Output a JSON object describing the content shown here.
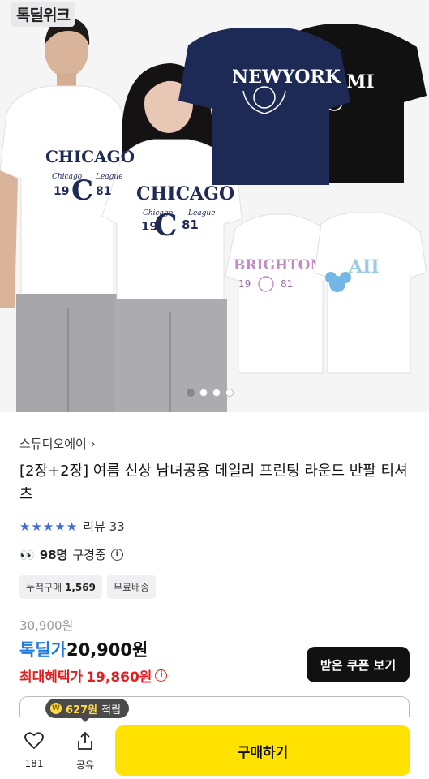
{
  "hero": {
    "badge": "톡딜위크",
    "carousel_pages": 4,
    "carousel_active": 1,
    "shirts": {
      "chicago_text": "CHICAGO",
      "chicago_sub_left": "Chicago",
      "chicago_sub_right": "League",
      "chicago_year_left": "19",
      "chicago_letter": "C",
      "chicago_year_right": "81",
      "newyork_text": "NEWYORK",
      "miami_text": "AMI",
      "brighton_text": "BRIGHTON",
      "brighton_year_left": "19",
      "brighton_year_right": "81",
      "hawaii_text": "AII"
    }
  },
  "product": {
    "seller": "스튜디오에이",
    "seller_chevron": "›",
    "title": "[2장+2장] 여름 신상 남녀공용 데일리 프린팅 라운드 반팔 티셔츠",
    "stars": "★★★★★",
    "review_label": "리뷰 33",
    "watch_icon": "👀",
    "watch_count": "98명",
    "watch_label": "구경중",
    "chips": {
      "purchase_label": "누적구매",
      "purchase_count": "1,569",
      "shipping": "무료배송"
    },
    "original_price": "30,900원",
    "deal_label": "톡딜가",
    "deal_price": "20,900원",
    "max_label": "최대혜택가",
    "max_price": "19,860원",
    "coupon_button": "받은 쿠폰 보기"
  },
  "bottom_bar": {
    "points_amount": "627원",
    "points_label": "적립",
    "like_count": "181",
    "share_label": "공유",
    "buy_label": "구매하기"
  },
  "colors": {
    "accent_blue": "#1d7ae0",
    "price_red": "#e02020",
    "buy_yellow": "#ffe200"
  }
}
